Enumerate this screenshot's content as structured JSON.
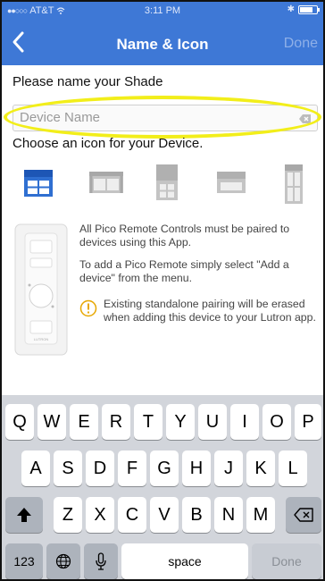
{
  "status_bar": {
    "carrier": "AT&T",
    "time": "3:11 PM"
  },
  "nav": {
    "title": "Name & Icon",
    "done_label": "Done"
  },
  "form": {
    "prompt": "Please name your Shade",
    "name_placeholder": "Device Name",
    "name_value": "",
    "icon_prompt": "Choose an icon for your Device.",
    "icons": [
      {
        "name": "roller-shade-icon",
        "selected": true
      },
      {
        "name": "drapery-icon",
        "selected": false
      },
      {
        "name": "honeycomb-shade-icon",
        "selected": false
      },
      {
        "name": "roman-shade-icon",
        "selected": false
      },
      {
        "name": "vertical-window-icon",
        "selected": false
      }
    ]
  },
  "info": {
    "line1": "All Pico Remote Controls must be paired to devices using this App.",
    "line2": "To add a Pico Remote simply select \"Add a device\" from the menu.",
    "warning": "Existing standalone pairing will be erased when adding this device to your Lutron app.",
    "pico_brand": "LUTRON"
  },
  "keyboard": {
    "row1": [
      "Q",
      "W",
      "E",
      "R",
      "T",
      "Y",
      "U",
      "I",
      "O",
      "P"
    ],
    "row2": [
      "A",
      "S",
      "D",
      "F",
      "G",
      "H",
      "J",
      "K",
      "L"
    ],
    "row3": [
      "Z",
      "X",
      "C",
      "V",
      "B",
      "N",
      "M"
    ],
    "numbers_label": "123",
    "space_label": "space",
    "done_label": "Done"
  },
  "colors": {
    "header": "#3e78d6",
    "highlight": "#f2ee1a",
    "icon_selected": "#2f6fd1",
    "icon_unselected": "#b8b8b8",
    "warning": "#e7a700"
  }
}
